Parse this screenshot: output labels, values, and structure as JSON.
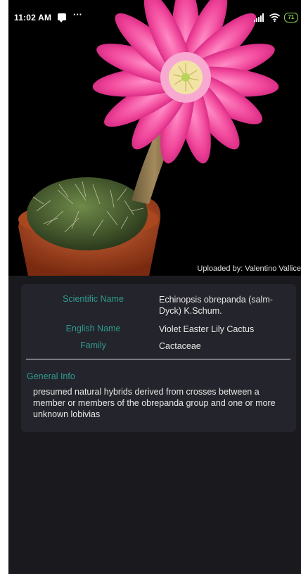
{
  "status_bar": {
    "time": "11:02 AM",
    "overflow": "···",
    "battery_level": "71",
    "icons": [
      "message-icon",
      "signal-icon",
      "wifi-icon",
      "battery-icon"
    ]
  },
  "hero": {
    "upload_credit": "Uploaded by: Valentino Vallice"
  },
  "details": {
    "rows": [
      {
        "label": "Scientific Name",
        "value": "Echinopsis obrepanda (salm-Dyck) K.Schum."
      },
      {
        "label": "English Name",
        "value": "Violet Easter Lily Cactus"
      },
      {
        "label": "Family",
        "value": "Cactaceae"
      }
    ],
    "general_info_heading": "General Info",
    "general_info_text": "presumed natural hybrids derived from crosses between a member or members of the obrepanda group and one or more unknown lobivias"
  },
  "colors": {
    "background": "#1a1a1e",
    "card": "#24242c",
    "accent_label": "#2f9b8c",
    "text": "#e8e8e8",
    "battery": "#8fd14f",
    "flower": "#f0469a"
  }
}
